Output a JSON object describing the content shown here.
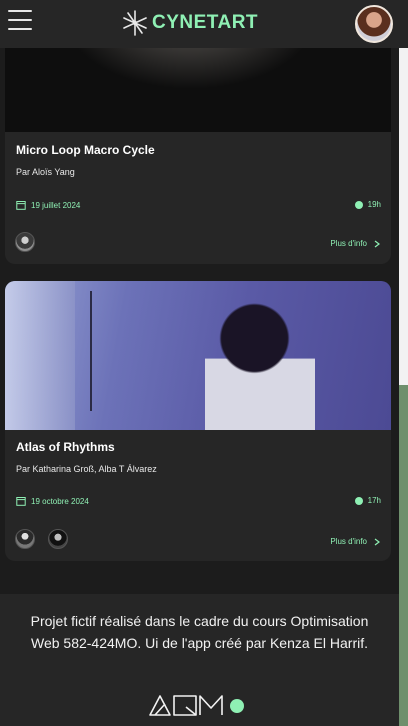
{
  "header": {
    "menu_icon": "hamburger-icon",
    "logo_text": "CYNETART",
    "logo_icon": "sparkle-icon",
    "avatar_icon": "user-avatar"
  },
  "events": [
    {
      "title": "Micro Loop Macro Cycle",
      "byline": "Par Aloïs Yang",
      "date": "19 juillet 2024",
      "time": "19h",
      "more_label": "Plus d'info"
    },
    {
      "title": "Atlas of Rhythms",
      "byline": "Par Katharina Groß, Alba T Álvarez",
      "date": "19 octobre 2024",
      "time": "17h",
      "more_label": "Plus d'info"
    }
  ],
  "footer": {
    "text": "Projet fictif réalisé dans le cadre du cours Optimisation Web 582-424MO. Ui de l'app créé par Kenza El Harrif.",
    "logo_icon": "aqm-logo"
  },
  "colors": {
    "accent": "#8ff0b4",
    "background": "#1c1c1c",
    "card": "#262626"
  }
}
